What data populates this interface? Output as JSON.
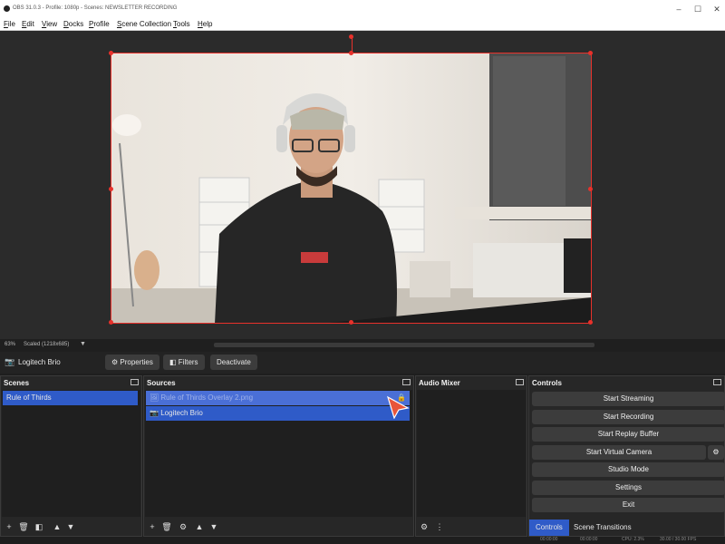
{
  "window": {
    "title": "OBS 31.0.3 - Profile: 1080p - Scenes: NEWSLETTER RECORDING"
  },
  "menu": [
    "File",
    "Edit",
    "View",
    "Docks",
    "Profile",
    "Scene Collection",
    "Tools",
    "Help"
  ],
  "preview": {
    "zoom": "63%",
    "scale_text": "Scaled (1218x685)"
  },
  "source_toolbar": {
    "source_name": "Logitech Brio",
    "properties": "Properties",
    "filters": "Filters",
    "deactivate": "Deactivate"
  },
  "scenes": {
    "header": "Scenes",
    "items": [
      "Rule of Thirds"
    ]
  },
  "sources": {
    "header": "Sources",
    "items": [
      {
        "name": "Rule of Thirds Overlay 2.png",
        "icon": "image-icon"
      },
      {
        "name": "Logitech Brio",
        "icon": "camera-icon"
      }
    ]
  },
  "audio_mixer": {
    "header": "Audio Mixer"
  },
  "controls": {
    "header": "Controls",
    "buttons": [
      "Start Streaming",
      "Start Recording",
      "Start Replay Buffer",
      "Start Virtual Camera",
      "Studio Mode",
      "Settings",
      "Exit"
    ],
    "tabs": [
      "Controls",
      "Scene Transitions"
    ]
  },
  "status": {
    "time1": "00:00:00",
    "time2": "00:00:00",
    "cpu": "CPU: 2.3%",
    "fps": "30.00 / 30.00 FPS"
  },
  "colors": {
    "selection": "#2f5bc8",
    "bounding_box": "#e8312b",
    "cursor": "#e8553a"
  }
}
